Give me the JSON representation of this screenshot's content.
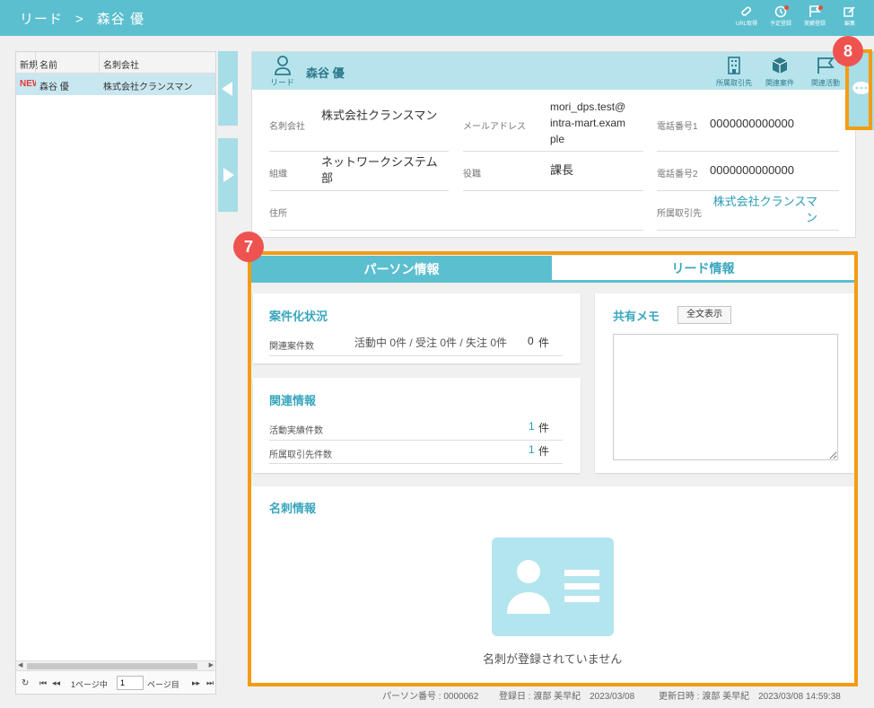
{
  "header": {
    "breadcrumb_root": "リード",
    "breadcrumb_sep": ">",
    "breadcrumb_current": "森谷 優",
    "buttons": [
      {
        "label": "URL取得",
        "icon": "link-icon"
      },
      {
        "label": "予定登録",
        "icon": "clock-icon"
      },
      {
        "label": "実績登録",
        "icon": "flag-icon"
      },
      {
        "label": "編集",
        "icon": "edit-icon"
      }
    ]
  },
  "list": {
    "columns": [
      "新規",
      "名前",
      "名刺会社"
    ],
    "rows": [
      {
        "new": "NEW",
        "name": "森谷 優",
        "company": "株式会社クランスマン"
      }
    ],
    "pager": {
      "refresh_icon": "refresh-icon",
      "first": "⏮",
      "prev": "◂◂",
      "page_of": "1ページ中",
      "page_value": "1",
      "page_suffix": "ページ目",
      "next": "▸▸",
      "last": "⏭"
    }
  },
  "detail": {
    "name": "森谷 優",
    "type_label": "リード",
    "actions": [
      {
        "label": "所属取引先",
        "icon": "building-icon"
      },
      {
        "label": "関連案件",
        "icon": "box-icon"
      },
      {
        "label": "関連活動",
        "icon": "flag-icon"
      }
    ],
    "fields": {
      "company_k": "名刺会社",
      "company_v": "株式会社クランスマン",
      "email_k": "メールアドレス",
      "email_v": "mori_dps.test@intra-mart.example",
      "phone1_k": "電話番号1",
      "phone1_v": "0000000000000",
      "org_k": "組織",
      "org_v": "ネットワークシステム部",
      "title_k": "役職",
      "title_v": "課長",
      "phone2_k": "電話番号2",
      "phone2_v": "0000000000000",
      "address_k": "住所",
      "address_v": "",
      "account_k": "所属取引先",
      "account_v": "株式会社クランスマン"
    }
  },
  "badges": {
    "b7": "7",
    "b8": "8"
  },
  "tabs": {
    "person": "パーソン情報",
    "lead": "リード情報"
  },
  "status": {
    "title": "案件化状況",
    "label": "関連案件数",
    "detail": "活動中 0件 / 受注 0件 / 失注 0件",
    "count": "0",
    "unit": "件"
  },
  "related": {
    "title": "関連情報",
    "activities_label": "活動実績件数",
    "activities_count": "1",
    "accounts_label": "所属取引先件数",
    "accounts_count": "1",
    "unit": "件"
  },
  "memo": {
    "title": "共有メモ",
    "button": "全文表示",
    "value": ""
  },
  "bizcard": {
    "title": "名刺情報",
    "empty": "名刺が登録されていません"
  },
  "footer": {
    "person_no": "パーソン番号 : 0000062",
    "registered": "登録日 : 渡部 美早紀　2023/03/08",
    "updated": "更新日時 : 渡部 美早紀　2023/03/08 14:59:38"
  },
  "colors": {
    "accent": "#5bbfcf",
    "highlight": "#f39c12",
    "badge": "#ef5350"
  }
}
